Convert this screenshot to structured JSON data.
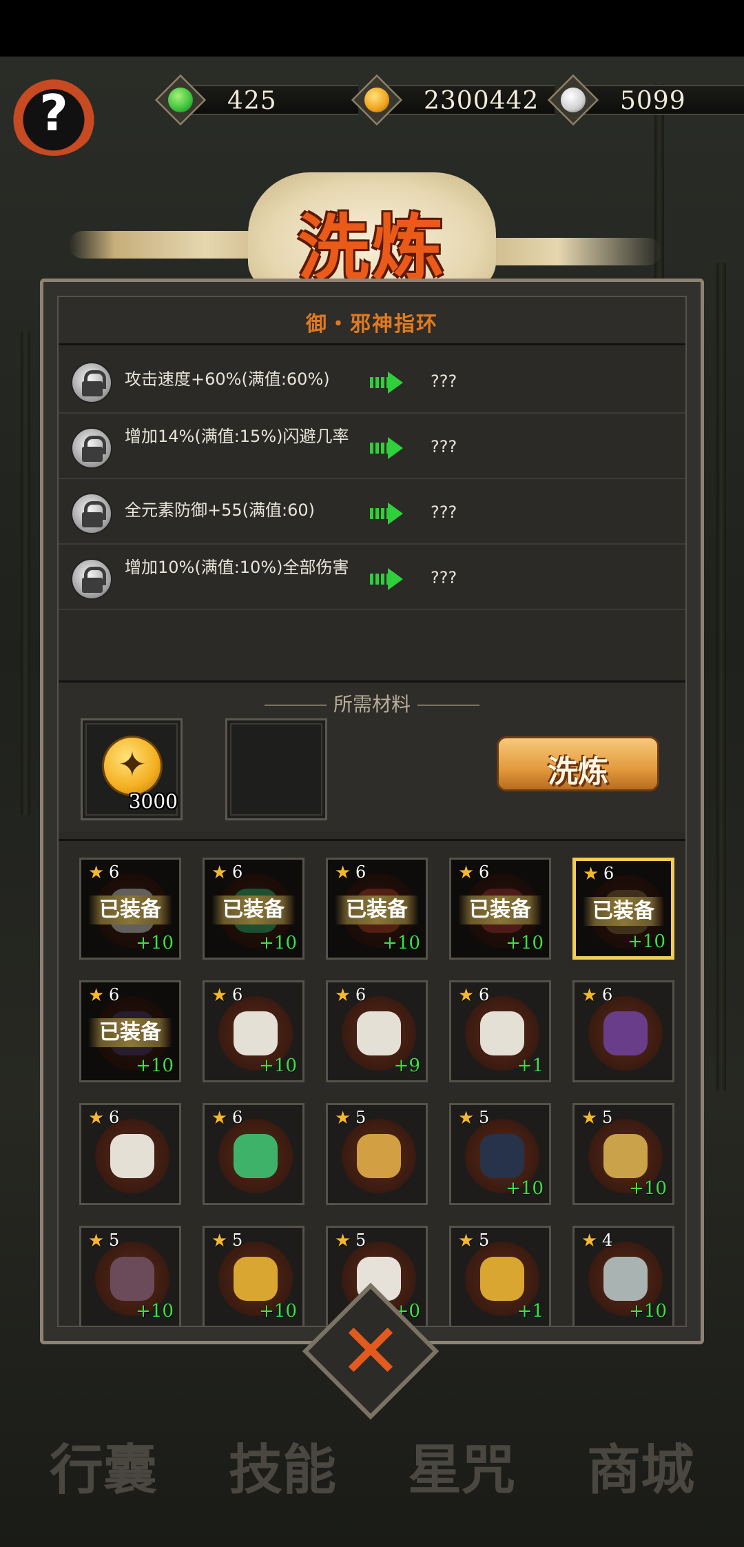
{
  "resources": [
    {
      "name": "jade",
      "icon": "green-drop-icon",
      "color": "#39c23a",
      "value": "425"
    },
    {
      "name": "gold",
      "icon": "gold-coin-icon",
      "color": "#f0a21c",
      "value": "2300442"
    },
    {
      "name": "silver",
      "icon": "silver-swirl-icon",
      "color": "#cfcfcf",
      "value": "5099"
    }
  ],
  "help_label": "?",
  "title": "洗炼",
  "item_name": "御・邪神指环",
  "attributes": [
    {
      "text": "攻击速度+60%(满值:60%)",
      "new": "???"
    },
    {
      "text": "增加14%(满值:15%)闪避几率",
      "new": "???"
    },
    {
      "text": "全元素防御+55(满值:60)",
      "new": "???"
    },
    {
      "text": "增加10%(满值:10%)全部伤害",
      "new": "???"
    }
  ],
  "materials": {
    "header": "所需材料",
    "slots": [
      {
        "icon": "gold-coin-icon",
        "count": "3000"
      },
      {
        "icon": "",
        "count": ""
      }
    ],
    "refine_button": "洗炼"
  },
  "inventory": [
    {
      "stars": "6",
      "level": "+10",
      "equipped": true,
      "tag": "已装备",
      "icon": "skull-mask-icon",
      "color": "#d9d6cf",
      "selected": false
    },
    {
      "stars": "6",
      "level": "+10",
      "equipped": true,
      "tag": "已装备",
      "icon": "jade-pendant-icon",
      "color": "#3fb26a",
      "selected": false
    },
    {
      "stars": "6",
      "level": "+10",
      "equipped": true,
      "tag": "已装备",
      "icon": "sword-icon",
      "color": "#b8452a",
      "selected": false
    },
    {
      "stars": "6",
      "level": "+10",
      "equipped": true,
      "tag": "已装备",
      "icon": "robe-icon",
      "color": "#b03b3b",
      "selected": false
    },
    {
      "stars": "6",
      "level": "+10",
      "equipped": true,
      "tag": "已装备",
      "icon": "ring-icon",
      "color": "#8a6b3a",
      "selected": true
    },
    {
      "stars": "6",
      "level": "+10",
      "equipped": true,
      "tag": "已装备",
      "icon": "crown-icon",
      "color": "#5a3f6d",
      "selected": false
    },
    {
      "stars": "6",
      "level": "+10",
      "equipped": false,
      "tag": "",
      "icon": "skull-mask-icon",
      "color": "#e4e0d6",
      "selected": false
    },
    {
      "stars": "6",
      "level": "+9",
      "equipped": false,
      "tag": "",
      "icon": "skull-mask-icon",
      "color": "#e4e0d6",
      "selected": false
    },
    {
      "stars": "6",
      "level": "+1",
      "equipped": false,
      "tag": "",
      "icon": "skull-mask-icon",
      "color": "#e4e0d6",
      "selected": false
    },
    {
      "stars": "6",
      "level": "",
      "equipped": false,
      "tag": "",
      "icon": "crown-icon",
      "color": "#6a3d8a",
      "selected": false
    },
    {
      "stars": "6",
      "level": "",
      "equipped": false,
      "tag": "",
      "icon": "skull-mask-icon",
      "color": "#e4e0d6",
      "selected": false
    },
    {
      "stars": "6",
      "level": "",
      "equipped": false,
      "tag": "",
      "icon": "jade-pendant-icon",
      "color": "#3fb26a",
      "selected": false
    },
    {
      "stars": "5",
      "level": "",
      "equipped": false,
      "tag": "",
      "icon": "gold-bracelet-icon",
      "color": "#d2a043",
      "selected": false
    },
    {
      "stars": "5",
      "level": "+10",
      "equipped": false,
      "tag": "",
      "icon": "robe-icon",
      "color": "#27334a",
      "selected": false
    },
    {
      "stars": "5",
      "level": "+10",
      "equipped": false,
      "tag": "",
      "icon": "ruby-necklace-icon",
      "color": "#c9a24a",
      "selected": false
    },
    {
      "stars": "5",
      "level": "+10",
      "equipped": false,
      "tag": "",
      "icon": "demon-mask-icon",
      "color": "#6b4a5a",
      "selected": false
    },
    {
      "stars": "5",
      "level": "+10",
      "equipped": false,
      "tag": "",
      "icon": "gold-bracelet-icon",
      "color": "#d9a631",
      "selected": false
    },
    {
      "stars": "5",
      "level": "+0",
      "equipped": false,
      "tag": "",
      "icon": "white-beast-icon",
      "color": "#e6e2da",
      "selected": false
    },
    {
      "stars": "5",
      "level": "+1",
      "equipped": false,
      "tag": "",
      "icon": "gold-bracelet-icon",
      "color": "#d9a631",
      "selected": false
    },
    {
      "stars": "4",
      "level": "+10",
      "equipped": false,
      "tag": "",
      "icon": "silver-ring-icon",
      "color": "#a9b3b1",
      "selected": false
    }
  ],
  "close_label": "✕",
  "bottom_nav": [
    "行囊",
    "技能",
    "星咒",
    "商城"
  ]
}
